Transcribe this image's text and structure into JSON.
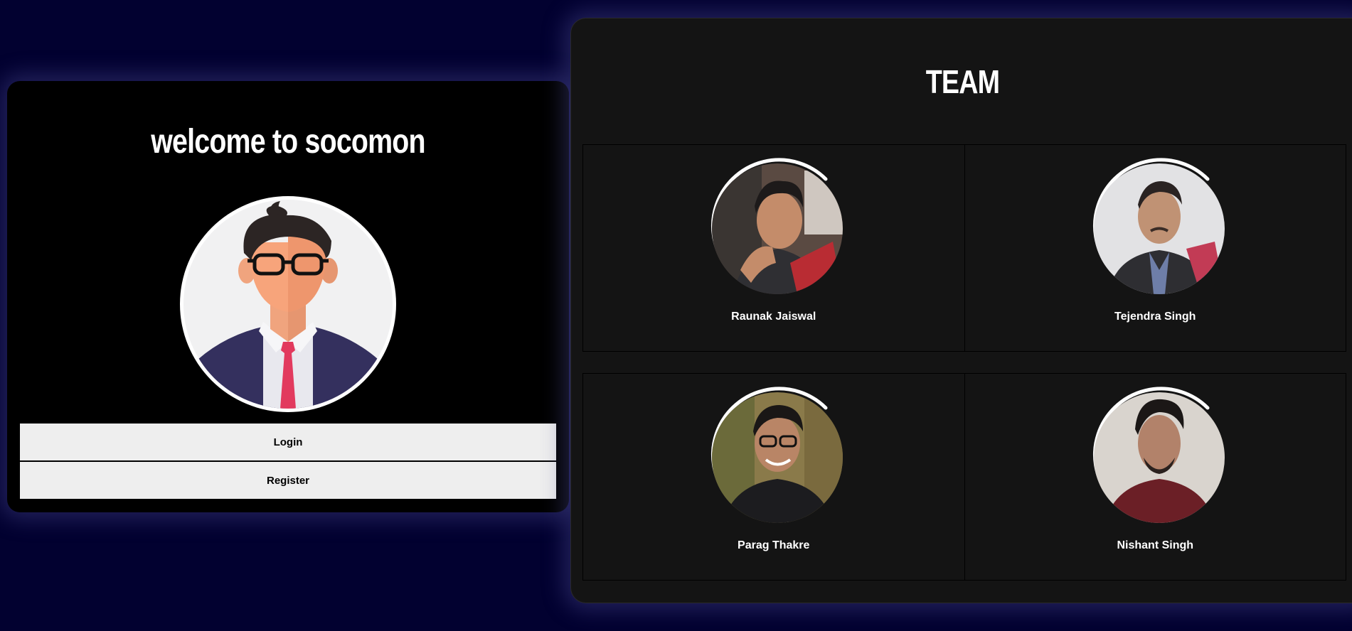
{
  "welcome": {
    "title": "welcome to socomon",
    "login_label": "Login",
    "register_label": "Register",
    "avatar_icon": "user-avatar-icon"
  },
  "team": {
    "title": "TEAM",
    "members": [
      {
        "name": "Raunak Jaiswal"
      },
      {
        "name": "Tejendra Singh"
      },
      {
        "name": "Parag Thakre"
      },
      {
        "name": "Nishant Singh"
      }
    ]
  },
  "colors": {
    "background": "#020130",
    "welcome_card": "#000000",
    "team_card": "#141414",
    "button": "#eeeeee",
    "text": "#ffffff"
  }
}
